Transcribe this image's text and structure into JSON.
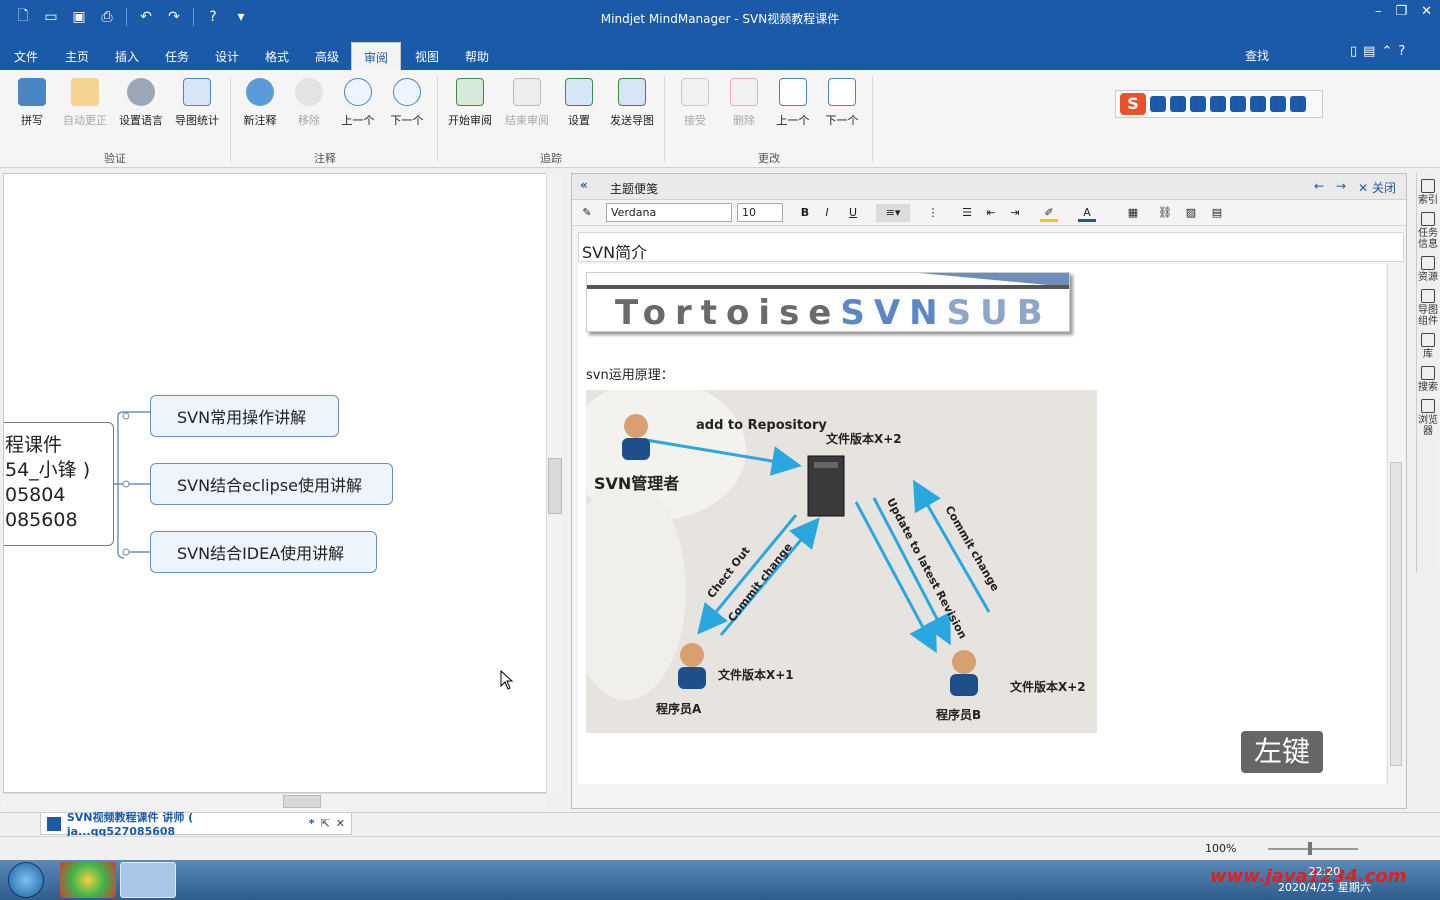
{
  "window": {
    "title": "Mindjet MindManager - SVN视频教程课件"
  },
  "tabs": [
    "文件",
    "主页",
    "插入",
    "任务",
    "设计",
    "格式",
    "高级",
    "审阅",
    "视图",
    "帮助"
  ],
  "active_tab": "审阅",
  "search_label": "查找",
  "ribbon": {
    "groups": {
      "verify": "验证",
      "comments": "注释",
      "track": "追踪",
      "changes": "更改"
    },
    "buttons": {
      "spell": "拼写",
      "autocorrect": "自动更正",
      "set_language": "设置语言",
      "map_stats": "导图统计",
      "new_comment": "新注释",
      "remove": "移除",
      "prev_comment": "上一个",
      "next_comment": "下一个",
      "start_review": "开始审阅",
      "end_review": "结束审阅",
      "settings": "设置",
      "send_map": "发送导图",
      "accept": "接受",
      "delete": "删除",
      "prev_change": "上一个",
      "next_change": "下一个"
    }
  },
  "map": {
    "central_lines": [
      "程课件",
      "54_小锋 )",
      "05804",
      "085608"
    ],
    "topics": [
      "SVN常用操作讲解",
      "SVN结合eclipse使用讲解",
      "SVN结合IDEA使用讲解"
    ]
  },
  "notes": {
    "header": "主题便笺",
    "close_label": "关闭",
    "font": "Verdana",
    "size": "10",
    "title": "SVN简介",
    "banner": {
      "part1": "Tortoise",
      "part2": "SVN",
      "part3": "SUB"
    },
    "principle_text": "svn运用原理：",
    "diagram": {
      "admin": "SVN管理者",
      "add_repo": "add to Repository",
      "version_top": "文件版本X+2",
      "checkout": "Chect Out",
      "commit1": "Commit change",
      "update": "Update to latest Revision",
      "commit2": "Commit change",
      "version_a": "文件版本X+1",
      "programmer_a": "程序员A",
      "programmer_b": "程序员B",
      "version_b": "文件版本X+2"
    }
  },
  "overlay_key": "左键",
  "rightbar": [
    "索引",
    "任务信息",
    "资源",
    "导图组件",
    "库",
    "搜索",
    "浏览器"
  ],
  "doc_tab": {
    "label": "SVN视频教程课件 讲师 ( ja...qq527085608",
    "modified": "*"
  },
  "status": {
    "zoom": "100%"
  },
  "taskbar": {
    "time": "22:20",
    "date": "2020/4/25 星期六",
    "watermark": "www.java1234.com"
  },
  "colors": {
    "titlebar": "#1b5aa8",
    "topic_border": "#6b8fb8",
    "topic_fill": "#eef4fb"
  }
}
